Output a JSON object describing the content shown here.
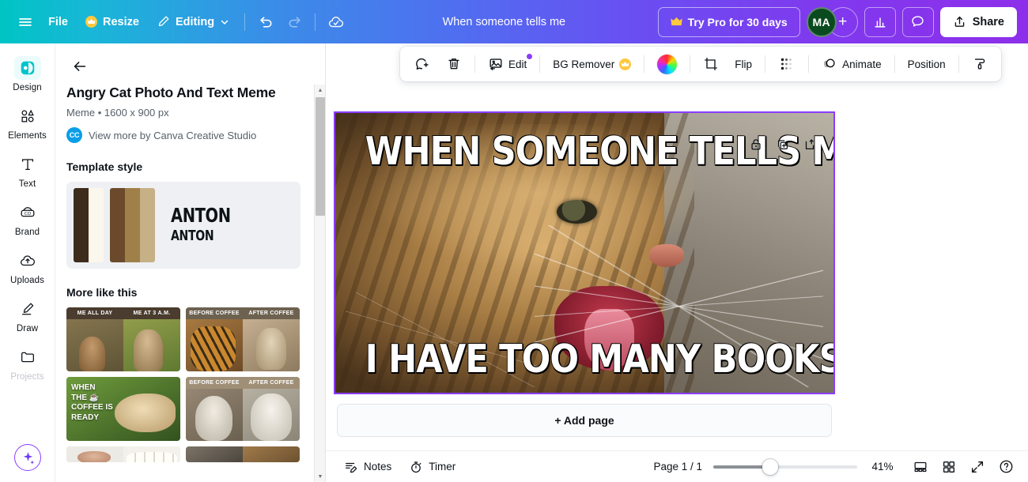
{
  "topbar": {
    "menu_icon": "hamburger-menu-icon",
    "file_label": "File",
    "resize_label": "Resize",
    "resize_icon": "crown-icon",
    "editing_label": "Editing",
    "editing_icon": "pencil-icon",
    "editing_caret": "chevron-down-icon",
    "undo_icon": "undo-arrow-icon",
    "redo_icon": "redo-arrow-icon",
    "cloud_save_icon": "cloud-saved-icon",
    "doc_title": "When someone tells me",
    "try_pro_label": "Try Pro for 30 days",
    "try_pro_icon": "crown-icon",
    "avatar_initials": "MA",
    "avatar_add_label": "+",
    "insights_icon": "bar-chart-icon",
    "comment_icon": "speech-bubble-icon",
    "share_label": "Share",
    "share_icon": "share-upload-icon",
    "gradient_start": "#00c4c4",
    "gradient_end": "#8d2fea"
  },
  "rail": {
    "items": [
      {
        "label": "Design",
        "icon": "design-icon",
        "active": true,
        "dim": false
      },
      {
        "label": "Elements",
        "icon": "elements-icon",
        "active": false,
        "dim": false
      },
      {
        "label": "Text",
        "icon": "text-icon",
        "active": false,
        "dim": false
      },
      {
        "label": "Brand",
        "icon": "brand-icon",
        "active": false,
        "dim": false
      },
      {
        "label": "Uploads",
        "icon": "uploads-icon",
        "active": false,
        "dim": false
      },
      {
        "label": "Draw",
        "icon": "draw-icon",
        "active": false,
        "dim": false
      },
      {
        "label": "Projects",
        "icon": "projects-icon",
        "active": false,
        "dim": true
      }
    ],
    "magic_icon": "magic-sparkle-icon"
  },
  "panel": {
    "back_icon": "back-arrow-icon",
    "template_title": "Angry Cat Photo And Text Meme",
    "template_meta": "Meme • 1600 x 900 px",
    "author_badge": "CC",
    "author_link": "View more by Canva Creative Studio",
    "style_section_title": "Template style",
    "style_card": {
      "swatches_left": [
        "#3d2b1b",
        "#fbf7ed"
      ],
      "swatches_right": [
        "#6b4a2c",
        "#a08049",
        "#c6b187"
      ],
      "font_primary": "ANTON",
      "font_secondary": "ANTON"
    },
    "more_section_title": "More like this",
    "thumbnails": [
      {
        "name": "monkey-meme",
        "captions": [
          "ME ALL DAY",
          "ME AT 3 A.M."
        ],
        "cap_bg": "#4a3c2e",
        "left_color": "#7a6a4a",
        "right_color": "#8f8451"
      },
      {
        "name": "tiger-kitten-coffee-meme",
        "captions": [
          "BEFORE COFFEE",
          "AFTER COFFEE"
        ],
        "cap_bg": "#6d6250",
        "left_color": "#9a6a3a",
        "right_color": "#c0a98b"
      },
      {
        "name": "dog-coffee-meme",
        "caption_full": "WHEN\nTHE ☕\nCOFFEE IS\nREADY",
        "left_color": "#3f6b28",
        "right_color": "#5b8a33"
      },
      {
        "name": "alpaca-coffee-meme",
        "captions": [
          "BEFORE COFFEE",
          "AFTER COFFEE"
        ],
        "cap_bg": "#9f8f76",
        "left_color": "#8f8573",
        "right_color": "#b3ad9c"
      },
      {
        "name": "dog-eggs-meme",
        "captions": [
          "",
          ""
        ],
        "cap_bg": "#d8d4cd",
        "left_color": "#c8b29a",
        "right_color": "#e8e5df"
      },
      {
        "name": "cat-meme",
        "captions": [
          "",
          ""
        ],
        "cap_bg": "#6f6a62",
        "left_color": "#6b6257",
        "right_color": "#8a6c45"
      }
    ],
    "scrollbar": {
      "up_arrow": "scroll-up-arrow",
      "down_arrow": "scroll-down-arrow"
    }
  },
  "object_toolbar": {
    "comment_icon": "add-comment-icon",
    "delete_icon": "trash-icon",
    "edit_label": "Edit",
    "edit_icon": "edit-image-icon",
    "bg_remover_label": "BG Remover",
    "bg_remover_icon": "crown-icon",
    "color_icon": "color-wheel-icon",
    "crop_icon": "crop-icon",
    "flip_label": "Flip",
    "transparency_icon": "transparency-icon",
    "animate_label": "Animate",
    "animate_icon": "animate-icon",
    "position_label": "Position",
    "more_icon": "paint-roller-icon"
  },
  "page_tools": {
    "lock_icon": "lock-icon",
    "duplicate_icon": "duplicate-page-icon",
    "export_icon": "export-page-icon"
  },
  "canvas": {
    "meme_top_text": "WHEN SOMEONE TELLS ME",
    "meme_bottom_text": "I HAVE TOO MANY BOOKS",
    "selection_color": "#8b3dff",
    "add_page_label": "+ Add page"
  },
  "bottombar": {
    "notes_label": "Notes",
    "notes_icon": "notes-icon",
    "timer_label": "Timer",
    "timer_icon": "timer-icon",
    "page_indicator": "Page 1 / 1",
    "zoom_value": "41%",
    "zoom_slider_percent": 41,
    "grid_view_icon": "page-view-icon",
    "thumbs_view_icon": "grid-view-icon",
    "fullscreen_icon": "fullscreen-icon",
    "help_icon": "help-icon"
  }
}
